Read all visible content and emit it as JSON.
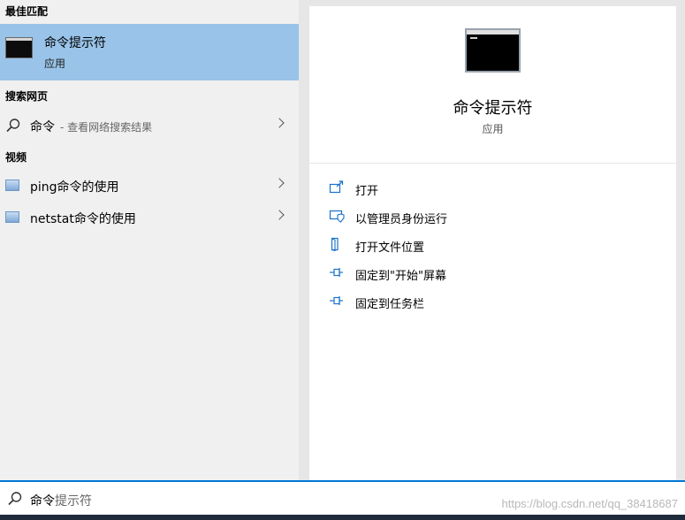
{
  "left": {
    "best_match_header": "最佳匹配",
    "best_match": {
      "title": "命令提示符",
      "subtitle": "应用",
      "icon": "cmd-terminal-icon"
    },
    "web_header": "搜索网页",
    "web_result": {
      "term": "命令",
      "hint": "- 查看网络搜索结果",
      "icon": "search-icon"
    },
    "video_header": "视频",
    "videos": [
      {
        "label": "ping命令的使用",
        "icon": "video-icon"
      },
      {
        "label": "netstat命令的使用",
        "icon": "video-icon"
      }
    ]
  },
  "detail": {
    "title": "命令提示符",
    "subtitle": "应用",
    "actions": [
      {
        "label": "打开",
        "icon": "open-icon"
      },
      {
        "label": "以管理员身份运行",
        "icon": "shield-icon"
      },
      {
        "label": "打开文件位置",
        "icon": "file-location-icon"
      },
      {
        "label": "固定到\"开始\"屏幕",
        "icon": "pin-icon"
      },
      {
        "label": "固定到任务栏",
        "icon": "pin-icon"
      }
    ]
  },
  "search": {
    "typed": "命令",
    "suggestion_rest": "提示符",
    "watermark": "https://blog.csdn.net/qq_38418687"
  },
  "colors": {
    "accent": "#0078d7",
    "selection": "#99c3e8",
    "icon_blue": "#1a73c9"
  }
}
